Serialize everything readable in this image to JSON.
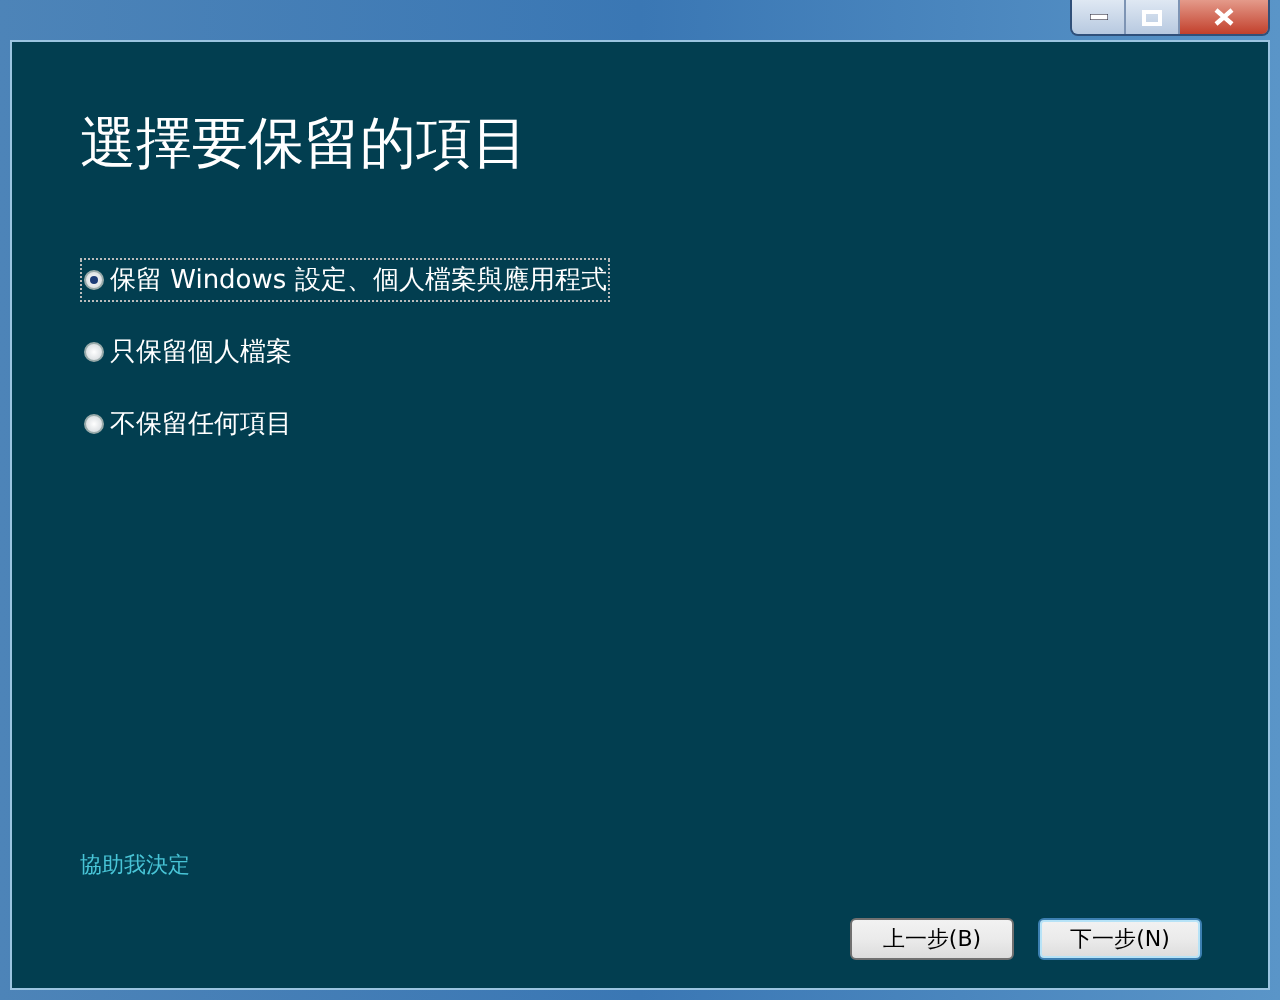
{
  "heading": "選擇要保留的項目",
  "options": [
    {
      "label": "保留 Windows 設定、個人檔案與應用程式",
      "selected": true
    },
    {
      "label": "只保留個人檔案",
      "selected": false
    },
    {
      "label": "不保留任何項目",
      "selected": false
    }
  ],
  "help_link": "協助我決定",
  "buttons": [
    {
      "label": "上一步(B)",
      "default": false
    },
    {
      "label": "下一步(N)",
      "default": true
    }
  ]
}
